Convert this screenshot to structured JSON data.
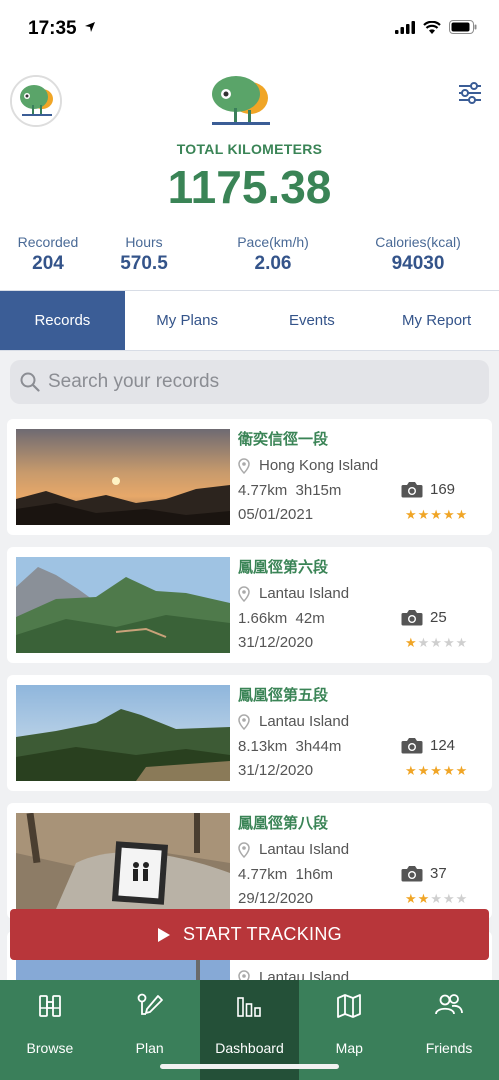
{
  "status_bar": {
    "time": "17:35"
  },
  "header": {
    "total_label": "TOTAL KILOMETERS",
    "total_value": "1175.38"
  },
  "stats": [
    {
      "label": "Recorded",
      "value": "204"
    },
    {
      "label": "Hours",
      "value": "570.5"
    },
    {
      "label": "Pace(km/h)",
      "value": "2.06"
    },
    {
      "label": "Calories(kcal)",
      "value": "94030"
    }
  ],
  "tabs": [
    {
      "label": "Records",
      "active": true
    },
    {
      "label": "My Plans",
      "active": false
    },
    {
      "label": "Events",
      "active": false
    },
    {
      "label": "My Report",
      "active": false
    }
  ],
  "search": {
    "placeholder": "Search your records"
  },
  "records": [
    {
      "title": "衛奕信徑一段",
      "location": "Hong Kong Island",
      "distance_time": "4.77km  3h15m",
      "date": "05/01/2021",
      "photos": "169",
      "rating": 5
    },
    {
      "title": "鳳凰徑第六段",
      "location": "Lantau Island",
      "distance_time": "1.66km  42m",
      "date": "31/12/2020",
      "photos": "25",
      "rating": 1
    },
    {
      "title": "鳳凰徑第五段",
      "location": "Lantau Island",
      "distance_time": "8.13km  3h44m",
      "date": "31/12/2020",
      "photos": "124",
      "rating": 5
    },
    {
      "title": "鳳凰徑第八段",
      "location": "Lantau Island",
      "distance_time": "4.77km  1h6m",
      "date": "29/12/2020",
      "photos": "37",
      "rating": 2
    },
    {
      "title": "",
      "location": "Lantau Island",
      "distance_time": "",
      "date": "",
      "photos": "",
      "rating": 0
    }
  ],
  "start_tracking": {
    "label": "START TRACKING"
  },
  "bottom_nav": [
    {
      "label": "Browse",
      "icon": "binoculars-icon",
      "active": false
    },
    {
      "label": "Plan",
      "icon": "pen-route-icon",
      "active": false
    },
    {
      "label": "Dashboard",
      "icon": "bar-chart-icon",
      "active": true
    },
    {
      "label": "Map",
      "icon": "map-icon",
      "active": false
    },
    {
      "label": "Friends",
      "icon": "friends-icon",
      "active": false
    }
  ],
  "colors": {
    "green": "#3a8456",
    "blue": "#3b5d96",
    "red": "#b8363a",
    "nav_green": "#3a7f5a",
    "nav_active": "#245038",
    "star": "#f0a526"
  }
}
